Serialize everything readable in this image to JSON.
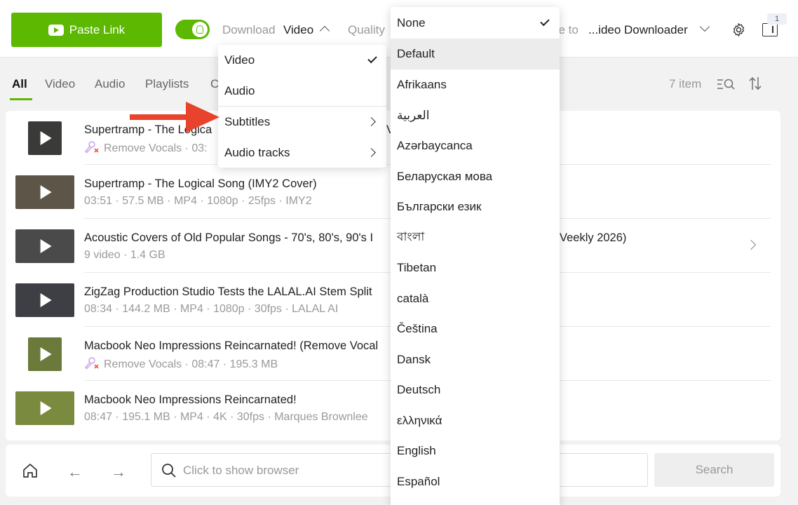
{
  "toolbar": {
    "paste_label": "Paste Link",
    "download_label": "Download",
    "download_value": "Video",
    "quality_label": "Quality",
    "saveto_label": "ve to",
    "saveto_value": "...ideo Downloader",
    "badge_count": "1"
  },
  "tabs": {
    "all": "All",
    "video": "Video",
    "audio": "Audio",
    "playlists": "Playlists",
    "channels": "C",
    "count": "7 item"
  },
  "rows": [
    {
      "title": "Supertramp - The Logica",
      "title_tail": "V",
      "meta": "Remove Vocals · 03:"
    },
    {
      "title": "Supertramp - The Logical Song (IMY2 Cover)",
      "meta": "03:51 · 57.5 MB · MP4 · 1080p · 25fps · IMY2"
    },
    {
      "title": "Acoustic Covers of Old Popular Songs - 70's, 80's, 90's I",
      "title_tail": "Veekly 2026)",
      "meta": "9 video · 1.4 GB"
    },
    {
      "title": "ZigZag Production Studio Tests the LALAL.AI Stem Split",
      "meta": "08:34 · 144.2 MB · MP4 · 1080p · 30fps · LALAL AI"
    },
    {
      "title": "Macbook Neo Impressions Reincarnated! (Remove Vocal",
      "meta": "Remove Vocals · 08:47 · 195.3 MB"
    },
    {
      "title": "Macbook Neo Impressions Reincarnated!",
      "meta": "08:47 · 195.1 MB · MP4 · 4K · 30fps · Marques Brownlee"
    }
  ],
  "bottom": {
    "search_placeholder": "Click to show browser",
    "search_button": "Search"
  },
  "download_menu": {
    "video": "Video",
    "audio": "Audio",
    "subtitles": "Subtitles",
    "audio_tracks": "Audio tracks"
  },
  "languages": [
    "None",
    "Default",
    "Afrikaans",
    "العربية",
    "Azərbaycanca",
    "Беларуская мова",
    "Български език",
    "বাংলা",
    "Tibetan",
    "català",
    "Čeština",
    "Dansk",
    "Deutsch",
    "ελληνικά",
    "English",
    "Español"
  ],
  "colors": {
    "accent": "#5cb800",
    "arrow": "#e8432c"
  }
}
